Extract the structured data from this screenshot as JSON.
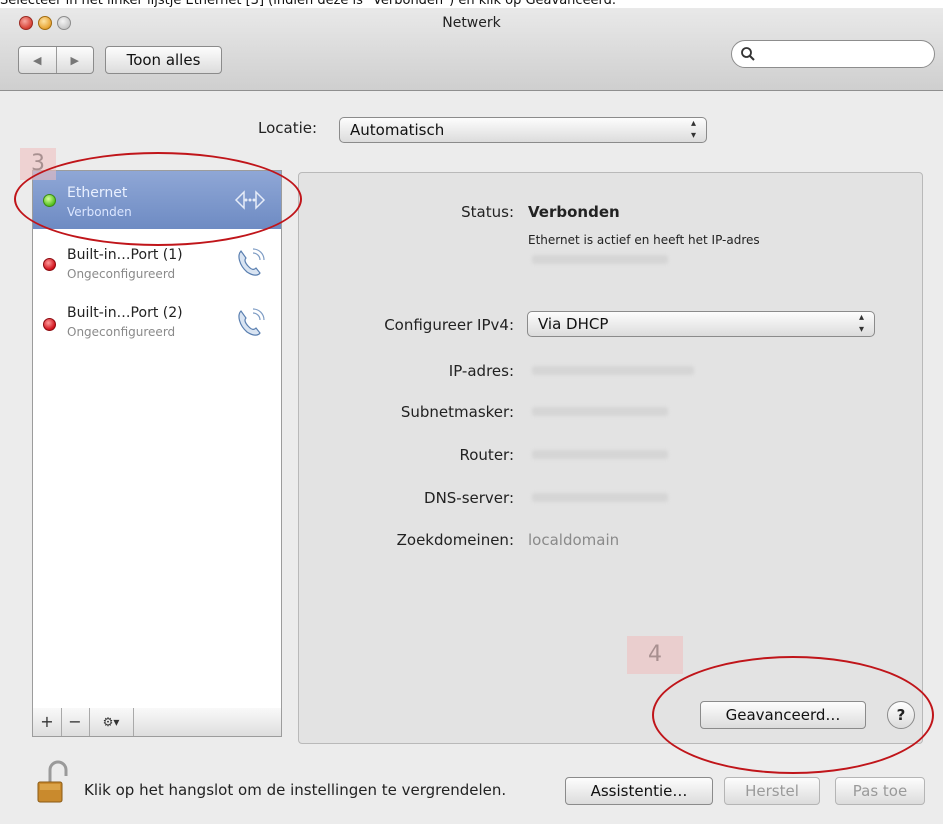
{
  "caption": "Selecteer in het linker lijstje Ethernet [3] (indien deze is \"Verbonden\") en klik op Geavanceerd.",
  "window": {
    "title": "Netwerk"
  },
  "toolbar": {
    "show_all": "Toon alles",
    "search_placeholder": ""
  },
  "location": {
    "label": "Locatie:",
    "value": "Automatisch"
  },
  "services": [
    {
      "name": "Ethernet",
      "status": "Verbonden",
      "dot": "green",
      "icon": "ethernet-arrows-icon",
      "selected": true
    },
    {
      "name": "Built-in…Port (1)",
      "status": "Ongeconfigureerd",
      "dot": "red",
      "icon": "phone-icon",
      "selected": false
    },
    {
      "name": "Built-in…Port (2)",
      "status": "Ongeconfigureerd",
      "dot": "red",
      "icon": "phone-icon",
      "selected": false
    }
  ],
  "list_controls": {
    "add": "+",
    "remove": "−",
    "action": "⚙▾"
  },
  "detail": {
    "status_label": "Status:",
    "status_value": "Verbonden",
    "status_note": "Ethernet is actief en heeft het IP-adres",
    "configure_label": "Configureer IPv4:",
    "configure_value": "Via DHCP",
    "ip_label": "IP-adres:",
    "subnet_label": "Subnetmasker:",
    "router_label": "Router:",
    "dns_label": "DNS-server:",
    "search_domains_label": "Zoekdomeinen:",
    "search_domains_value": "localdomain"
  },
  "buttons": {
    "advanced": "Geavanceerd…",
    "help": "?",
    "assistant": "Assistentie…",
    "revert": "Herstel",
    "apply": "Pas toe"
  },
  "lock_text": "Klik op het hangslot om de instellingen te vergrendelen.",
  "annotations": {
    "step3": "3",
    "step4": "4"
  },
  "colors": {
    "highlight_ring": "#c0151a",
    "selection": "#7b96cb"
  }
}
